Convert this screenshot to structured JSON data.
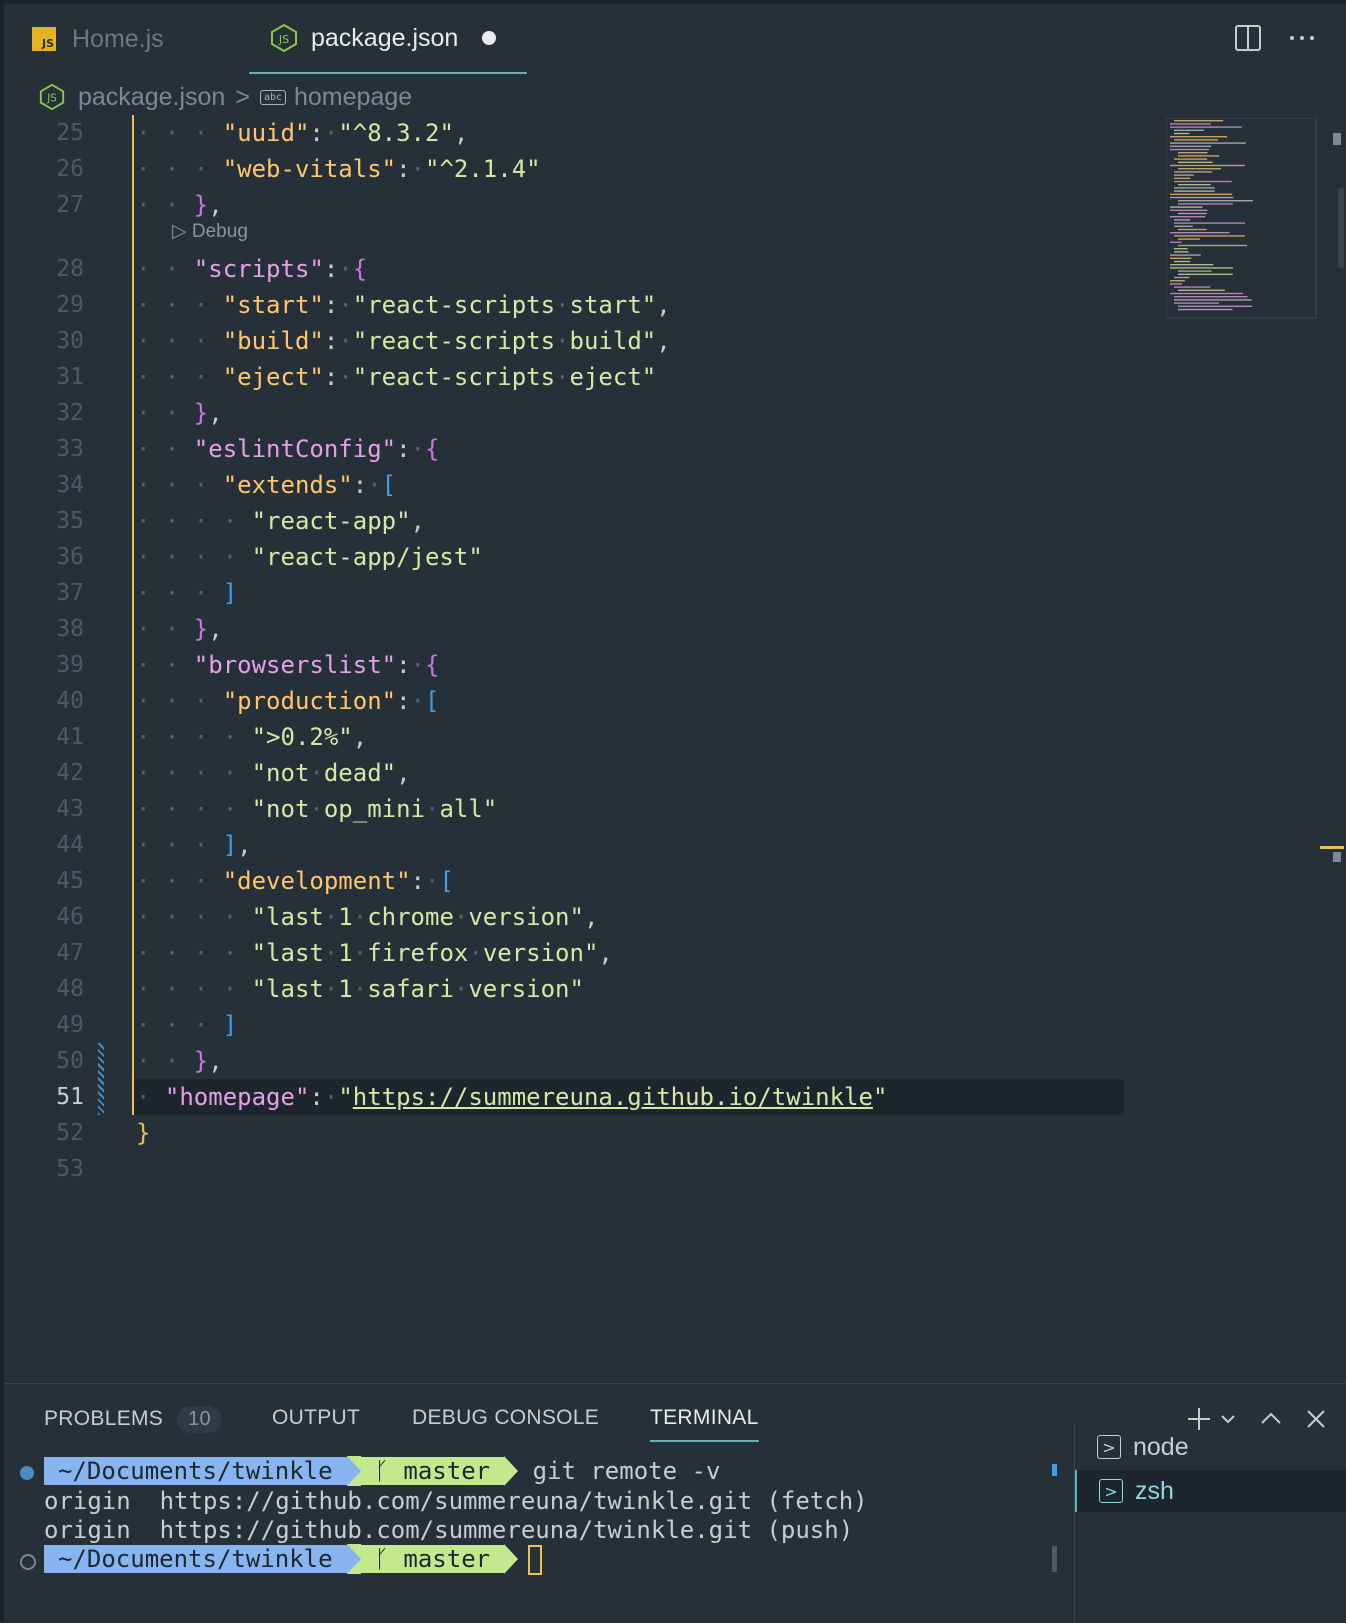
{
  "tabs": [
    {
      "label": "Home.js",
      "icon": "js-file-icon",
      "badge": "JS"
    },
    {
      "label": "package.json",
      "icon": "nodejs-file-icon",
      "dirty": true
    }
  ],
  "breadcrumb": {
    "file": "package.json",
    "sep": ">",
    "symbol": "homepage",
    "symbol_icon": "abc"
  },
  "codelens": "▷ Debug",
  "editor_lines": [
    {
      "n": "25",
      "segs": [
        [
          "ws",
          "· · · "
        ],
        [
          "k",
          "\"uuid\""
        ],
        [
          "p",
          ":"
        ],
        [
          "ws",
          "·"
        ],
        [
          "s",
          "\"^8.3.2\""
        ],
        [
          "p",
          ","
        ]
      ]
    },
    {
      "n": "26",
      "segs": [
        [
          "ws",
          "· · · "
        ],
        [
          "k",
          "\"web-vitals\""
        ],
        [
          "p",
          ":"
        ],
        [
          "ws",
          "·"
        ],
        [
          "s",
          "\"^2.1.4\""
        ]
      ]
    },
    {
      "n": "27",
      "segs": [
        [
          "ws",
          "· · "
        ],
        [
          "b2",
          "}"
        ],
        [
          "p",
          ","
        ]
      ]
    },
    {
      "n": "28",
      "segs": [
        [
          "ws",
          "· · "
        ],
        [
          "k2",
          "\"scripts\""
        ],
        [
          "p",
          ":"
        ],
        [
          "ws",
          "·"
        ],
        [
          "b2",
          "{"
        ]
      ]
    },
    {
      "n": "29",
      "segs": [
        [
          "ws",
          "· · · "
        ],
        [
          "k",
          "\"start\""
        ],
        [
          "p",
          ":"
        ],
        [
          "ws",
          "·"
        ],
        [
          "s",
          "\"react-scripts"
        ],
        [
          "ws",
          "·"
        ],
        [
          "s",
          "start\""
        ],
        [
          "p",
          ","
        ]
      ]
    },
    {
      "n": "30",
      "segs": [
        [
          "ws",
          "· · · "
        ],
        [
          "k",
          "\"build\""
        ],
        [
          "p",
          ":"
        ],
        [
          "ws",
          "·"
        ],
        [
          "s",
          "\"react-scripts"
        ],
        [
          "ws",
          "·"
        ],
        [
          "s",
          "build\""
        ],
        [
          "p",
          ","
        ]
      ]
    },
    {
      "n": "31",
      "segs": [
        [
          "ws",
          "· · · "
        ],
        [
          "k",
          "\"eject\""
        ],
        [
          "p",
          ":"
        ],
        [
          "ws",
          "·"
        ],
        [
          "s",
          "\"react-scripts"
        ],
        [
          "ws",
          "·"
        ],
        [
          "s",
          "eject\""
        ]
      ]
    },
    {
      "n": "32",
      "segs": [
        [
          "ws",
          "· · "
        ],
        [
          "b2",
          "}"
        ],
        [
          "p",
          ","
        ]
      ]
    },
    {
      "n": "33",
      "segs": [
        [
          "ws",
          "· · "
        ],
        [
          "k2",
          "\"eslintConfig\""
        ],
        [
          "p",
          ":"
        ],
        [
          "ws",
          "·"
        ],
        [
          "b2",
          "{"
        ]
      ]
    },
    {
      "n": "34",
      "segs": [
        [
          "ws",
          "· · · "
        ],
        [
          "k",
          "\"extends\""
        ],
        [
          "p",
          ":"
        ],
        [
          "ws",
          "·"
        ],
        [
          "b3",
          "["
        ]
      ]
    },
    {
      "n": "35",
      "segs": [
        [
          "ws",
          "· · · · "
        ],
        [
          "s",
          "\"react-app\""
        ],
        [
          "p",
          ","
        ]
      ]
    },
    {
      "n": "36",
      "segs": [
        [
          "ws",
          "· · · · "
        ],
        [
          "s",
          "\"react-app/jest\""
        ]
      ]
    },
    {
      "n": "37",
      "segs": [
        [
          "ws",
          "· · · "
        ],
        [
          "b3",
          "]"
        ]
      ]
    },
    {
      "n": "38",
      "segs": [
        [
          "ws",
          "· · "
        ],
        [
          "b2",
          "}"
        ],
        [
          "p",
          ","
        ]
      ]
    },
    {
      "n": "39",
      "segs": [
        [
          "ws",
          "· · "
        ],
        [
          "k2",
          "\"browserslist\""
        ],
        [
          "p",
          ":"
        ],
        [
          "ws",
          "·"
        ],
        [
          "b2",
          "{"
        ]
      ]
    },
    {
      "n": "40",
      "segs": [
        [
          "ws",
          "· · · "
        ],
        [
          "k",
          "\"production\""
        ],
        [
          "p",
          ":"
        ],
        [
          "ws",
          "·"
        ],
        [
          "b3",
          "["
        ]
      ]
    },
    {
      "n": "41",
      "segs": [
        [
          "ws",
          "· · · · "
        ],
        [
          "s",
          "\">0.2%\""
        ],
        [
          "p",
          ","
        ]
      ]
    },
    {
      "n": "42",
      "segs": [
        [
          "ws",
          "· · · · "
        ],
        [
          "s",
          "\"not"
        ],
        [
          "ws",
          "·"
        ],
        [
          "s",
          "dead\""
        ],
        [
          "p",
          ","
        ]
      ]
    },
    {
      "n": "43",
      "segs": [
        [
          "ws",
          "· · · · "
        ],
        [
          "s",
          "\"not"
        ],
        [
          "ws",
          "·"
        ],
        [
          "s",
          "op_mini"
        ],
        [
          "ws",
          "·"
        ],
        [
          "s",
          "all\""
        ]
      ]
    },
    {
      "n": "44",
      "segs": [
        [
          "ws",
          "· · · "
        ],
        [
          "b3",
          "]"
        ],
        [
          "p",
          ","
        ]
      ]
    },
    {
      "n": "45",
      "segs": [
        [
          "ws",
          "· · · "
        ],
        [
          "k",
          "\"development\""
        ],
        [
          "p",
          ":"
        ],
        [
          "ws",
          "·"
        ],
        [
          "b3",
          "["
        ]
      ]
    },
    {
      "n": "46",
      "segs": [
        [
          "ws",
          "· · · · "
        ],
        [
          "s",
          "\"last"
        ],
        [
          "ws",
          "·"
        ],
        [
          "s",
          "1"
        ],
        [
          "ws",
          "·"
        ],
        [
          "s",
          "chrome"
        ],
        [
          "ws",
          "·"
        ],
        [
          "s",
          "version\""
        ],
        [
          "p",
          ","
        ]
      ]
    },
    {
      "n": "47",
      "segs": [
        [
          "ws",
          "· · · · "
        ],
        [
          "s",
          "\"last"
        ],
        [
          "ws",
          "·"
        ],
        [
          "s",
          "1"
        ],
        [
          "ws",
          "·"
        ],
        [
          "s",
          "firefox"
        ],
        [
          "ws",
          "·"
        ],
        [
          "s",
          "version\""
        ],
        [
          "p",
          ","
        ]
      ]
    },
    {
      "n": "48",
      "segs": [
        [
          "ws",
          "· · · · "
        ],
        [
          "s",
          "\"last"
        ],
        [
          "ws",
          "·"
        ],
        [
          "s",
          "1"
        ],
        [
          "ws",
          "·"
        ],
        [
          "s",
          "safari"
        ],
        [
          "ws",
          "·"
        ],
        [
          "s",
          "version\""
        ]
      ]
    },
    {
      "n": "49",
      "segs": [
        [
          "ws",
          "· · · "
        ],
        [
          "b3",
          "]"
        ]
      ]
    },
    {
      "n": "50",
      "segs": [
        [
          "ws",
          "· · "
        ],
        [
          "b2",
          "}"
        ],
        [
          "p",
          ","
        ]
      ]
    },
    {
      "n": "51",
      "active": true,
      "segs": [
        [
          "ws",
          "· "
        ],
        [
          "k2",
          "\"homepage\""
        ],
        [
          "p",
          ":"
        ],
        [
          "ws",
          "·"
        ],
        [
          "s",
          "\""
        ],
        [
          "url",
          "https://summereuna.github.io/twinkle"
        ],
        [
          "s",
          "\""
        ]
      ]
    },
    {
      "n": "52",
      "segs": [
        [
          "b1",
          "}"
        ]
      ]
    },
    {
      "n": "53",
      "segs": []
    }
  ],
  "panel": {
    "tabs": [
      "PROBLEMS",
      "OUTPUT",
      "DEBUG CONSOLE",
      "TERMINAL"
    ],
    "problems_count": "10",
    "active_tab": "TERMINAL"
  },
  "terminal": {
    "prompt_path": "~/Documents/twinkle",
    "branch_symbol": "ᚴ",
    "branch": "master",
    "command": "git remote -v",
    "output": [
      "origin  https://github.com/summereuna/twinkle.git (fetch)",
      "origin  https://github.com/summereuna/twinkle.git (push)"
    ]
  },
  "terminal_list": [
    {
      "label": "node",
      "active": false
    },
    {
      "label": "zsh",
      "active": true
    }
  ],
  "colors": {
    "background": "#263039",
    "key": "#ffc66d",
    "string": "#d9e7a6",
    "accent": "#5fb3b3",
    "path_segment": "#88b5f0",
    "branch_segment": "#c3e88d"
  }
}
